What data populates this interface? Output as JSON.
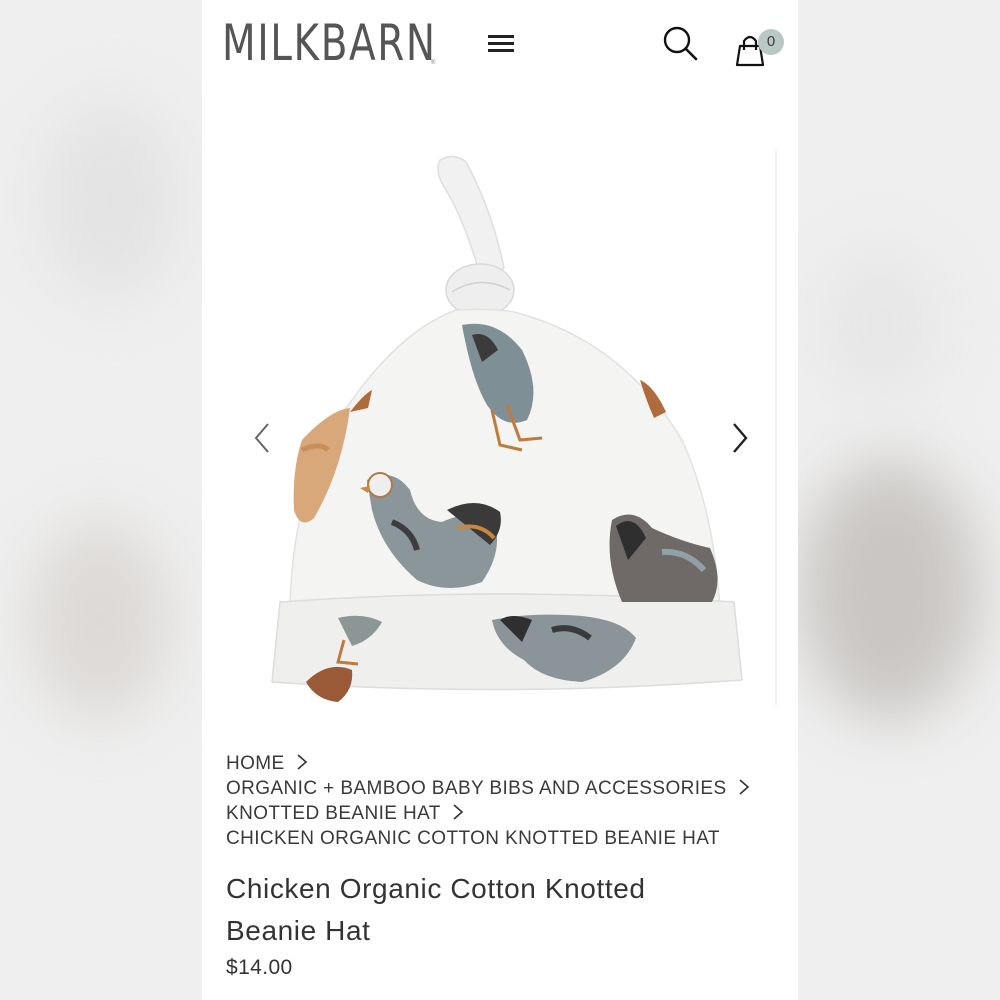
{
  "header": {
    "logo": "MILKBARN",
    "cart_count": "0"
  },
  "icons": {
    "menu": "hamburger-menu-icon",
    "search": "search-icon",
    "cart": "shopping-bag-icon",
    "prev": "chevron-left-icon",
    "next": "chevron-right-icon",
    "crumb_separator": "chevron-right-icon"
  },
  "breadcrumb": [
    {
      "label": "HOME"
    },
    {
      "label": "ORGANIC + BAMBOO BABY BIBS AND ACCESSORIES"
    },
    {
      "label": "KNOTTED BEANIE HAT"
    },
    {
      "label": "CHICKEN ORGANIC COTTON KNOTTED BEANIE HAT"
    }
  ],
  "product": {
    "title_line1": "Chicken Organic Cotton Knotted",
    "title_line2": "Beanie Hat",
    "price": "$14.00"
  },
  "colors": {
    "badge": "#b9c8c4",
    "text": "#333333",
    "background": "#ffffff"
  }
}
